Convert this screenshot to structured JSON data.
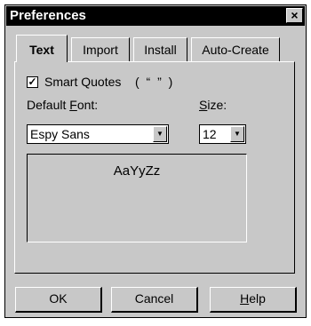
{
  "window": {
    "title": "Preferences",
    "close_glyph": "×"
  },
  "tabs": [
    {
      "label": "Text",
      "active": true
    },
    {
      "label": "Import",
      "active": false
    },
    {
      "label": "Install",
      "active": false
    },
    {
      "label": "Auto-Create",
      "active": false
    }
  ],
  "text_tab": {
    "smart_quotes": {
      "label": "Smart Quotes",
      "checked": true,
      "check_glyph": "✓",
      "sample": "( “ ” )"
    },
    "default_font": {
      "label_prefix": "Default ",
      "label_mnemonic": "F",
      "label_suffix": "ont:",
      "value": "Espy Sans"
    },
    "size": {
      "label_mnemonic": "S",
      "label_suffix": "ize:",
      "value": "12"
    },
    "preview_text": "AaYyZz",
    "dropdown_glyph": "▼"
  },
  "buttons": {
    "ok": "OK",
    "cancel": "Cancel",
    "help_mnemonic": "H",
    "help_suffix": "elp"
  }
}
